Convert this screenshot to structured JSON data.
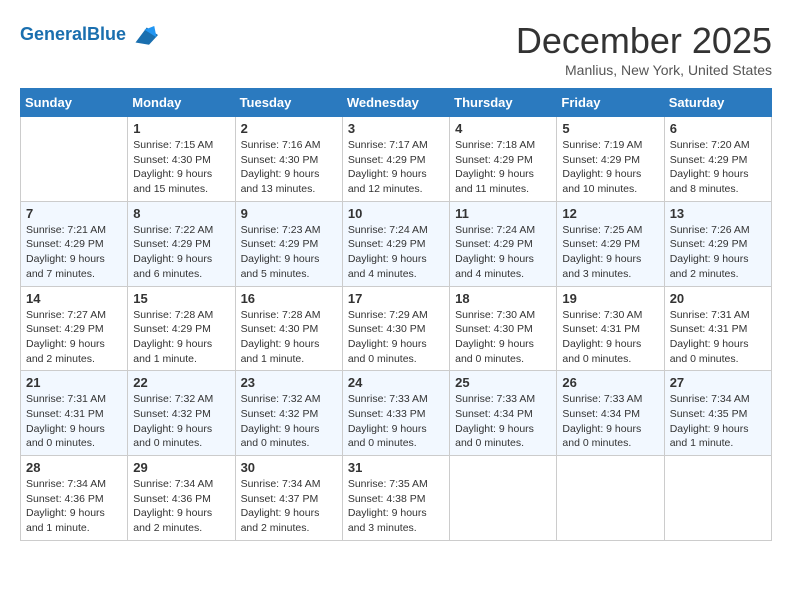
{
  "header": {
    "logo_line1": "General",
    "logo_line2": "Blue",
    "month_title": "December 2025",
    "location": "Manlius, New York, United States"
  },
  "days_of_week": [
    "Sunday",
    "Monday",
    "Tuesday",
    "Wednesday",
    "Thursday",
    "Friday",
    "Saturday"
  ],
  "weeks": [
    [
      {
        "day": "",
        "sunrise": "",
        "sunset": "",
        "daylight": ""
      },
      {
        "day": "1",
        "sunrise": "Sunrise: 7:15 AM",
        "sunset": "Sunset: 4:30 PM",
        "daylight": "Daylight: 9 hours and 15 minutes."
      },
      {
        "day": "2",
        "sunrise": "Sunrise: 7:16 AM",
        "sunset": "Sunset: 4:30 PM",
        "daylight": "Daylight: 9 hours and 13 minutes."
      },
      {
        "day": "3",
        "sunrise": "Sunrise: 7:17 AM",
        "sunset": "Sunset: 4:29 PM",
        "daylight": "Daylight: 9 hours and 12 minutes."
      },
      {
        "day": "4",
        "sunrise": "Sunrise: 7:18 AM",
        "sunset": "Sunset: 4:29 PM",
        "daylight": "Daylight: 9 hours and 11 minutes."
      },
      {
        "day": "5",
        "sunrise": "Sunrise: 7:19 AM",
        "sunset": "Sunset: 4:29 PM",
        "daylight": "Daylight: 9 hours and 10 minutes."
      },
      {
        "day": "6",
        "sunrise": "Sunrise: 7:20 AM",
        "sunset": "Sunset: 4:29 PM",
        "daylight": "Daylight: 9 hours and 8 minutes."
      }
    ],
    [
      {
        "day": "7",
        "sunrise": "Sunrise: 7:21 AM",
        "sunset": "Sunset: 4:29 PM",
        "daylight": "Daylight: 9 hours and 7 minutes."
      },
      {
        "day": "8",
        "sunrise": "Sunrise: 7:22 AM",
        "sunset": "Sunset: 4:29 PM",
        "daylight": "Daylight: 9 hours and 6 minutes."
      },
      {
        "day": "9",
        "sunrise": "Sunrise: 7:23 AM",
        "sunset": "Sunset: 4:29 PM",
        "daylight": "Daylight: 9 hours and 5 minutes."
      },
      {
        "day": "10",
        "sunrise": "Sunrise: 7:24 AM",
        "sunset": "Sunset: 4:29 PM",
        "daylight": "Daylight: 9 hours and 4 minutes."
      },
      {
        "day": "11",
        "sunrise": "Sunrise: 7:24 AM",
        "sunset": "Sunset: 4:29 PM",
        "daylight": "Daylight: 9 hours and 4 minutes."
      },
      {
        "day": "12",
        "sunrise": "Sunrise: 7:25 AM",
        "sunset": "Sunset: 4:29 PM",
        "daylight": "Daylight: 9 hours and 3 minutes."
      },
      {
        "day": "13",
        "sunrise": "Sunrise: 7:26 AM",
        "sunset": "Sunset: 4:29 PM",
        "daylight": "Daylight: 9 hours and 2 minutes."
      }
    ],
    [
      {
        "day": "14",
        "sunrise": "Sunrise: 7:27 AM",
        "sunset": "Sunset: 4:29 PM",
        "daylight": "Daylight: 9 hours and 2 minutes."
      },
      {
        "day": "15",
        "sunrise": "Sunrise: 7:28 AM",
        "sunset": "Sunset: 4:29 PM",
        "daylight": "Daylight: 9 hours and 1 minute."
      },
      {
        "day": "16",
        "sunrise": "Sunrise: 7:28 AM",
        "sunset": "Sunset: 4:30 PM",
        "daylight": "Daylight: 9 hours and 1 minute."
      },
      {
        "day": "17",
        "sunrise": "Sunrise: 7:29 AM",
        "sunset": "Sunset: 4:30 PM",
        "daylight": "Daylight: 9 hours and 0 minutes."
      },
      {
        "day": "18",
        "sunrise": "Sunrise: 7:30 AM",
        "sunset": "Sunset: 4:30 PM",
        "daylight": "Daylight: 9 hours and 0 minutes."
      },
      {
        "day": "19",
        "sunrise": "Sunrise: 7:30 AM",
        "sunset": "Sunset: 4:31 PM",
        "daylight": "Daylight: 9 hours and 0 minutes."
      },
      {
        "day": "20",
        "sunrise": "Sunrise: 7:31 AM",
        "sunset": "Sunset: 4:31 PM",
        "daylight": "Daylight: 9 hours and 0 minutes."
      }
    ],
    [
      {
        "day": "21",
        "sunrise": "Sunrise: 7:31 AM",
        "sunset": "Sunset: 4:31 PM",
        "daylight": "Daylight: 9 hours and 0 minutes."
      },
      {
        "day": "22",
        "sunrise": "Sunrise: 7:32 AM",
        "sunset": "Sunset: 4:32 PM",
        "daylight": "Daylight: 9 hours and 0 minutes."
      },
      {
        "day": "23",
        "sunrise": "Sunrise: 7:32 AM",
        "sunset": "Sunset: 4:32 PM",
        "daylight": "Daylight: 9 hours and 0 minutes."
      },
      {
        "day": "24",
        "sunrise": "Sunrise: 7:33 AM",
        "sunset": "Sunset: 4:33 PM",
        "daylight": "Daylight: 9 hours and 0 minutes."
      },
      {
        "day": "25",
        "sunrise": "Sunrise: 7:33 AM",
        "sunset": "Sunset: 4:34 PM",
        "daylight": "Daylight: 9 hours and 0 minutes."
      },
      {
        "day": "26",
        "sunrise": "Sunrise: 7:33 AM",
        "sunset": "Sunset: 4:34 PM",
        "daylight": "Daylight: 9 hours and 0 minutes."
      },
      {
        "day": "27",
        "sunrise": "Sunrise: 7:34 AM",
        "sunset": "Sunset: 4:35 PM",
        "daylight": "Daylight: 9 hours and 1 minute."
      }
    ],
    [
      {
        "day": "28",
        "sunrise": "Sunrise: 7:34 AM",
        "sunset": "Sunset: 4:36 PM",
        "daylight": "Daylight: 9 hours and 1 minute."
      },
      {
        "day": "29",
        "sunrise": "Sunrise: 7:34 AM",
        "sunset": "Sunset: 4:36 PM",
        "daylight": "Daylight: 9 hours and 2 minutes."
      },
      {
        "day": "30",
        "sunrise": "Sunrise: 7:34 AM",
        "sunset": "Sunset: 4:37 PM",
        "daylight": "Daylight: 9 hours and 2 minutes."
      },
      {
        "day": "31",
        "sunrise": "Sunrise: 7:35 AM",
        "sunset": "Sunset: 4:38 PM",
        "daylight": "Daylight: 9 hours and 3 minutes."
      },
      {
        "day": "",
        "sunrise": "",
        "sunset": "",
        "daylight": ""
      },
      {
        "day": "",
        "sunrise": "",
        "sunset": "",
        "daylight": ""
      },
      {
        "day": "",
        "sunrise": "",
        "sunset": "",
        "daylight": ""
      }
    ]
  ]
}
